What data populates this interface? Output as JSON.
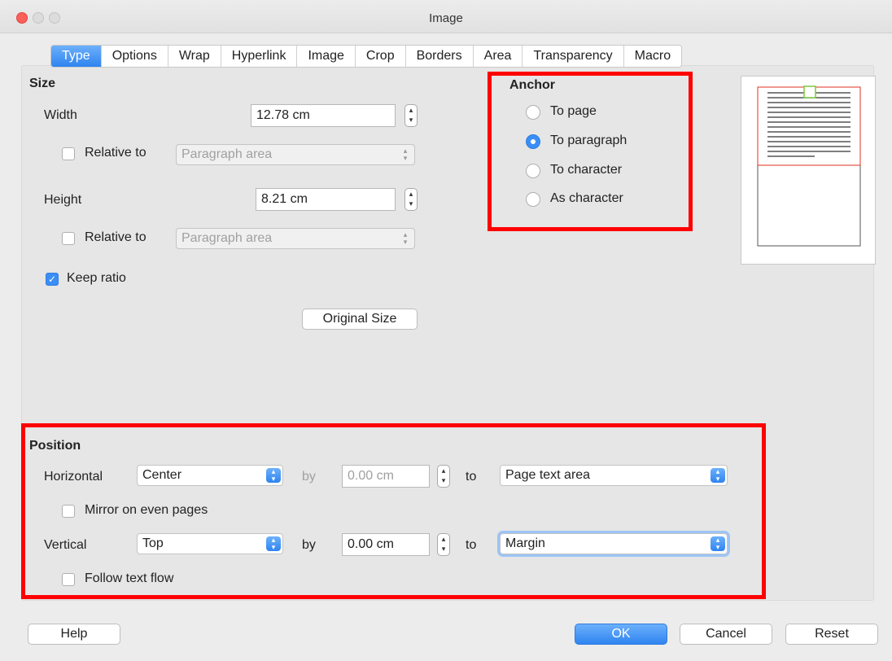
{
  "window": {
    "title": "Image"
  },
  "tabs": [
    "Type",
    "Options",
    "Wrap",
    "Hyperlink",
    "Image",
    "Crop",
    "Borders",
    "Area",
    "Transparency",
    "Macro"
  ],
  "size": {
    "heading": "Size",
    "width_label": "Width",
    "width_value": "12.78 cm",
    "relative_to_label": "Relative to",
    "relative_width_select": "Paragraph area",
    "height_label": "Height",
    "height_value": "8.21 cm",
    "relative_height_select": "Paragraph area",
    "keep_ratio_label": "Keep ratio",
    "original_size_button": "Original Size"
  },
  "anchor": {
    "heading": "Anchor",
    "options": [
      "To page",
      "To paragraph",
      "To character",
      "As character"
    ],
    "selected": "To paragraph"
  },
  "position": {
    "heading": "Position",
    "horizontal_label": "Horizontal",
    "horizontal_value": "Center",
    "by_label": "by",
    "horizontal_by": "0.00 cm",
    "to_label": "to",
    "horizontal_to": "Page text area",
    "mirror_label": "Mirror on even pages",
    "vertical_label": "Vertical",
    "vertical_value": "Top",
    "vertical_by": "0.00 cm",
    "vertical_to": "Margin",
    "follow_label": "Follow text flow"
  },
  "buttons": {
    "help": "Help",
    "ok": "OK",
    "cancel": "Cancel",
    "reset": "Reset"
  },
  "colors": {
    "accent": "#3b8ef5",
    "highlight": "#ff0000"
  }
}
